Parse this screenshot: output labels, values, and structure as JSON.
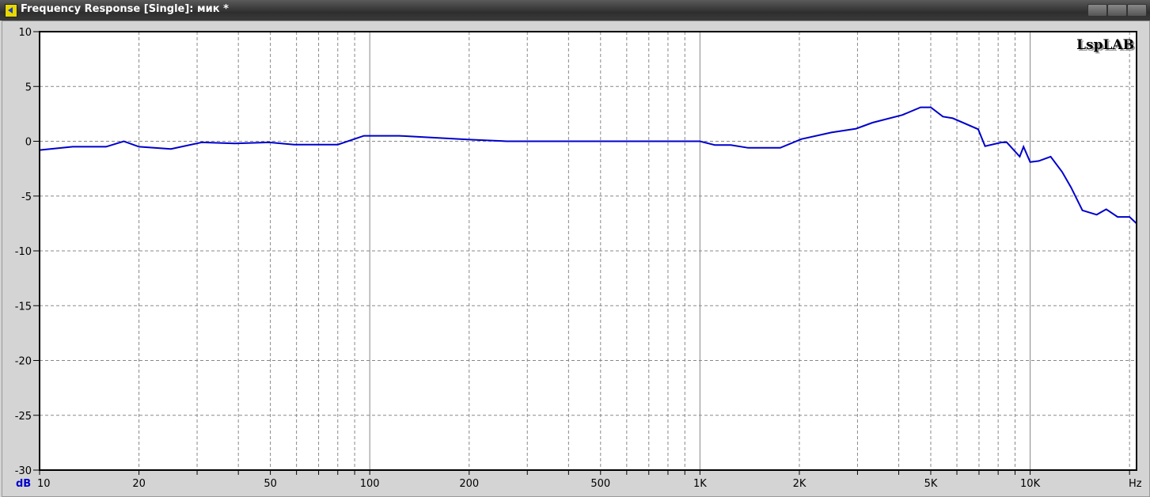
{
  "window": {
    "title": "Frequency Response [Single]: мик *"
  },
  "chart_data": {
    "type": "line",
    "title": "",
    "watermark": "LspLAB",
    "xlabel": "Hz",
    "ylabel": "dB",
    "xscale": "log",
    "xlim": [
      10,
      21000
    ],
    "ylim": [
      -30,
      10
    ],
    "grid": true,
    "x_ticks": [
      {
        "v": 10,
        "l": "10"
      },
      {
        "v": 20,
        "l": "20"
      },
      {
        "v": 50,
        "l": "50"
      },
      {
        "v": 100,
        "l": "100"
      },
      {
        "v": 200,
        "l": "200"
      },
      {
        "v": 500,
        "l": "500"
      },
      {
        "v": 1000,
        "l": "1K"
      },
      {
        "v": 2000,
        "l": "2K"
      },
      {
        "v": 5000,
        "l": "5K"
      },
      {
        "v": 10000,
        "l": "10K"
      }
    ],
    "y_ticks": [
      10,
      5,
      0,
      -5,
      -10,
      -15,
      -20,
      -25,
      -30
    ],
    "series": [
      {
        "name": "мик",
        "color": "#0000cc",
        "x": [
          10,
          12.6,
          15.9,
          18,
          20,
          25,
          31,
          39,
          49.6,
          59,
          80,
          96,
          123,
          200,
          260,
          1000,
          1110,
          1240,
          1400,
          1750,
          2030,
          2500,
          2970,
          3330,
          4100,
          4660,
          5000,
          5440,
          5830,
          6960,
          7300,
          8200,
          8500,
          9300,
          9550,
          10000,
          10620,
          11540,
          12500,
          13300,
          14400,
          15900,
          17000,
          18400,
          20000,
          21000
        ],
        "y": [
          -0.8,
          -0.5,
          -0.5,
          0,
          -0.5,
          -0.7,
          -0.1,
          -0.2,
          -0.1,
          -0.3,
          -0.3,
          0.5,
          0.5,
          0.15,
          0,
          0,
          -0.35,
          -0.35,
          -0.6,
          -0.6,
          0.2,
          0.8,
          1.15,
          1.7,
          2.4,
          3.1,
          3.1,
          2.25,
          2.1,
          1.1,
          -0.45,
          -0.1,
          -0.1,
          -1.4,
          -0.5,
          -1.9,
          -1.8,
          -1.4,
          -2.8,
          -4.2,
          -6.3,
          -6.7,
          -6.2,
          -6.9,
          -6.9,
          -7.5
        ]
      }
    ]
  }
}
